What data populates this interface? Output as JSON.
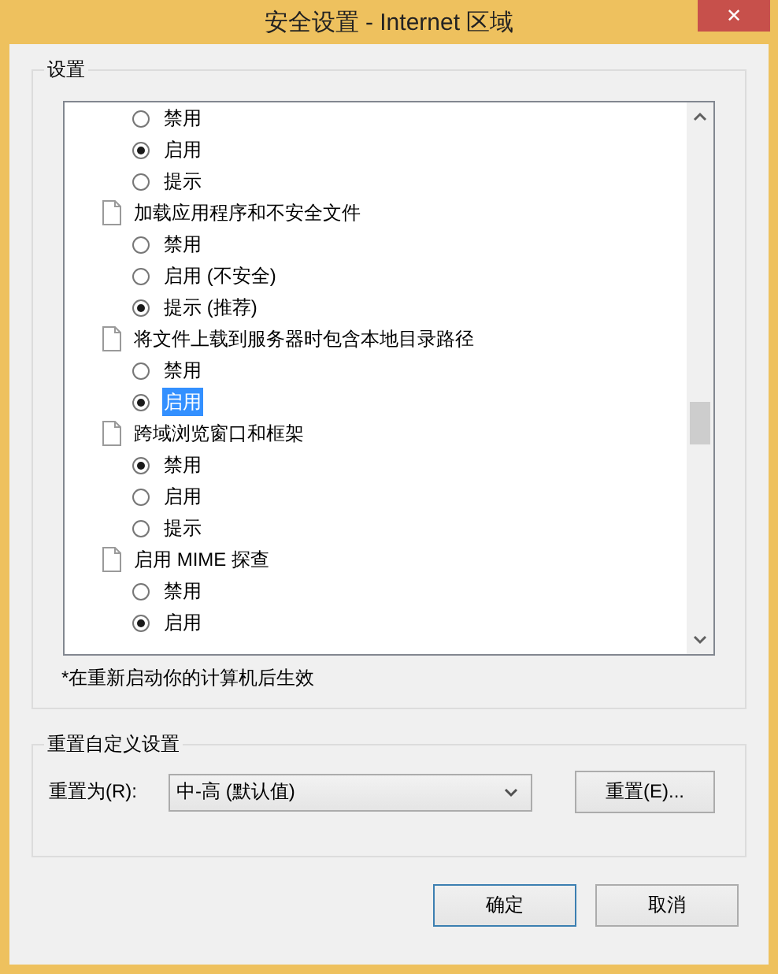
{
  "window": {
    "title": "安全设置 - Internet 区域",
    "close": "✕"
  },
  "settings": {
    "legend": "设置",
    "items": [
      {
        "kind": "option",
        "label": "禁用",
        "selected": false,
        "highlighted": false
      },
      {
        "kind": "option",
        "label": "启用",
        "selected": true,
        "highlighted": false
      },
      {
        "kind": "option",
        "label": "提示",
        "selected": false,
        "highlighted": false
      },
      {
        "kind": "header",
        "label": "加载应用程序和不安全文件"
      },
      {
        "kind": "option",
        "label": "禁用",
        "selected": false,
        "highlighted": false
      },
      {
        "kind": "option",
        "label": "启用 (不安全)",
        "selected": false,
        "highlighted": false
      },
      {
        "kind": "option",
        "label": "提示 (推荐)",
        "selected": true,
        "highlighted": false
      },
      {
        "kind": "header",
        "label": "将文件上载到服务器时包含本地目录路径"
      },
      {
        "kind": "option",
        "label": "禁用",
        "selected": false,
        "highlighted": false
      },
      {
        "kind": "option",
        "label": "启用",
        "selected": true,
        "highlighted": true
      },
      {
        "kind": "header",
        "label": "跨域浏览窗口和框架"
      },
      {
        "kind": "option",
        "label": "禁用",
        "selected": true,
        "highlighted": false
      },
      {
        "kind": "option",
        "label": "启用",
        "selected": false,
        "highlighted": false
      },
      {
        "kind": "option",
        "label": "提示",
        "selected": false,
        "highlighted": false
      },
      {
        "kind": "header",
        "label": "启用 MIME 探查"
      },
      {
        "kind": "option",
        "label": "禁用",
        "selected": false,
        "highlighted": false
      },
      {
        "kind": "option",
        "label": "启用",
        "selected": true,
        "highlighted": false
      }
    ],
    "note": "*在重新启动你的计算机后生效"
  },
  "reset": {
    "legend": "重置自定义设置",
    "label": "重置为(R):",
    "value": "中-高 (默认值)",
    "button": "重置(E)..."
  },
  "buttons": [
    "确定",
    "取消"
  ]
}
